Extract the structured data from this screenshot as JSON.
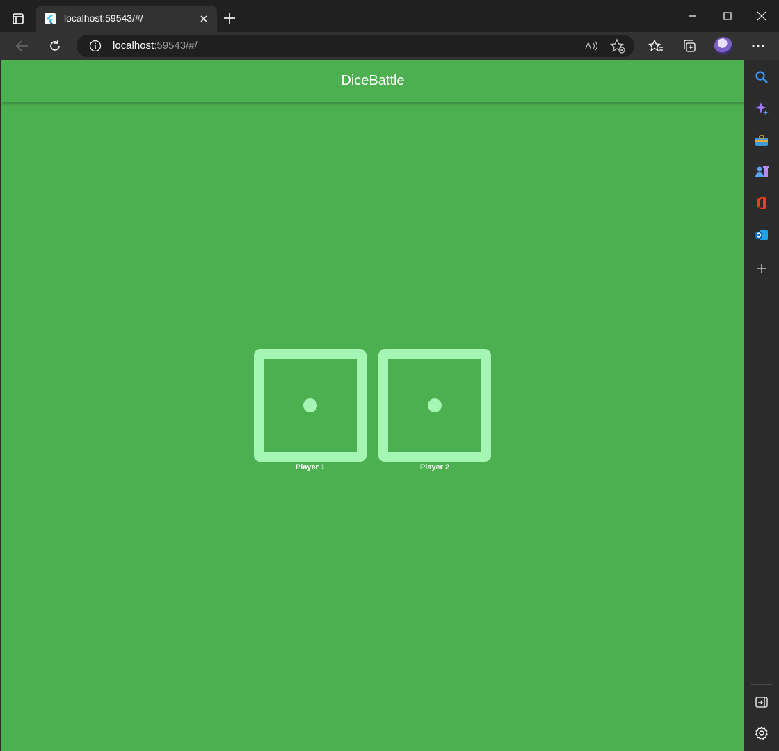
{
  "browser": {
    "tab": {
      "title": "localhost:59543/#/",
      "favicon": "flutter-icon"
    },
    "address": {
      "host": "localhost",
      "rest": ":59543/#/"
    },
    "toolbar_icons": [
      "back-icon",
      "refresh-icon",
      "read-aloud-icon",
      "add-favorite-icon",
      "favorites-icon",
      "collections-icon",
      "profile-avatar",
      "more-icon"
    ],
    "sidebar_icons": [
      "search-icon",
      "copilot-icon",
      "tools-icon",
      "games-icon",
      "office-icon",
      "outlook-icon",
      "add-icon",
      "hide-sidebar-icon",
      "settings-icon"
    ]
  },
  "app": {
    "title": "DiceBattle",
    "background_color": "#4caf50",
    "die_color": "#a5f5b5",
    "dice": [
      {
        "label": "Player 1",
        "value": 1
      },
      {
        "label": "Player 2",
        "value": 1
      }
    ]
  }
}
